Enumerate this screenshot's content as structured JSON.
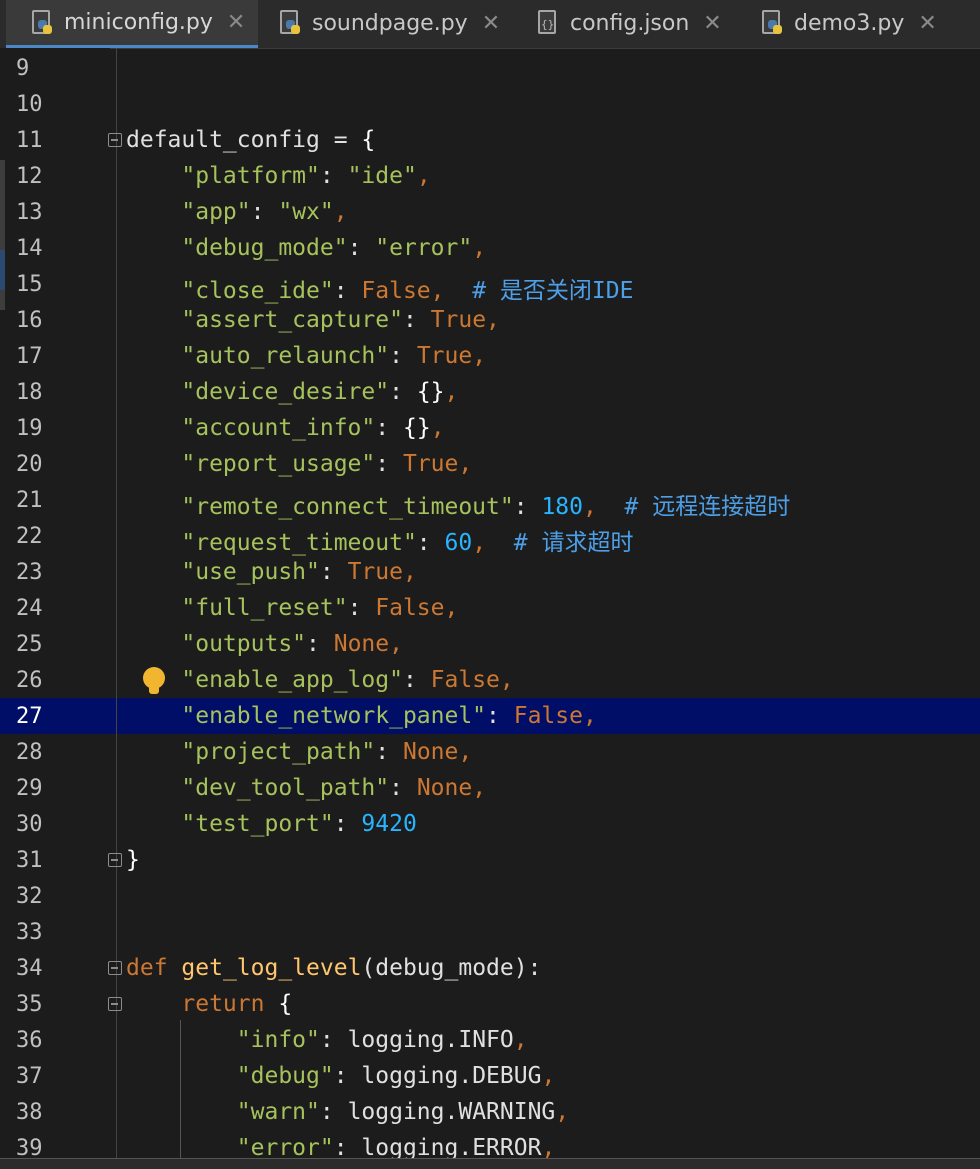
{
  "tabs": [
    {
      "label": "miniconfig.py",
      "icon": "python-file-icon",
      "active": true
    },
    {
      "label": "soundpage.py",
      "icon": "python-file-icon",
      "active": false
    },
    {
      "label": "config.json",
      "icon": "json-file-icon",
      "active": false
    },
    {
      "label": "demo3.py",
      "icon": "python-file-icon",
      "active": false
    }
  ],
  "editor": {
    "highlighted_line": 27,
    "lines": [
      {
        "num": "9",
        "code": ""
      },
      {
        "num": "10",
        "code": ""
      },
      {
        "num": "11",
        "code": "default_config = {"
      },
      {
        "num": "12",
        "code": "    \"platform\": \"ide\","
      },
      {
        "num": "13",
        "code": "    \"app\": \"wx\","
      },
      {
        "num": "14",
        "code": "    \"debug_mode\": \"error\","
      },
      {
        "num": "15",
        "code": "    \"close_ide\": False,  # 是否关闭IDE"
      },
      {
        "num": "16",
        "code": "    \"assert_capture\": True,"
      },
      {
        "num": "17",
        "code": "    \"auto_relaunch\": True,"
      },
      {
        "num": "18",
        "code": "    \"device_desire\": {},"
      },
      {
        "num": "19",
        "code": "    \"account_info\": {},"
      },
      {
        "num": "20",
        "code": "    \"report_usage\": True,"
      },
      {
        "num": "21",
        "code": "    \"remote_connect_timeout\": 180,  # 远程连接超时"
      },
      {
        "num": "22",
        "code": "    \"request_timeout\": 60,  # 请求超时"
      },
      {
        "num": "23",
        "code": "    \"use_push\": True,"
      },
      {
        "num": "24",
        "code": "    \"full_reset\": False,"
      },
      {
        "num": "25",
        "code": "    \"outputs\": None,"
      },
      {
        "num": "26",
        "code": "    \"enable_app_log\": False,"
      },
      {
        "num": "27",
        "code": "    \"enable_network_panel\": False,"
      },
      {
        "num": "28",
        "code": "    \"project_path\": None,"
      },
      {
        "num": "29",
        "code": "    \"dev_tool_path\": None,"
      },
      {
        "num": "30",
        "code": "    \"test_port\": 9420"
      },
      {
        "num": "31",
        "code": "}"
      },
      {
        "num": "32",
        "code": ""
      },
      {
        "num": "33",
        "code": ""
      },
      {
        "num": "34",
        "code": "def get_log_level(debug_mode):"
      },
      {
        "num": "35",
        "code": "    return {"
      },
      {
        "num": "36",
        "code": "        \"info\": logging.INFO,"
      },
      {
        "num": "37",
        "code": "        \"debug\": logging.DEBUG,"
      },
      {
        "num": "38",
        "code": "        \"warn\": logging.WARNING,"
      },
      {
        "num": "39",
        "code": "        \"error\": logging.ERROR,"
      }
    ]
  },
  "colors": {
    "background": "#1c1c1c",
    "highlight": "#000e68",
    "keyword": "#cc7832",
    "string": "#a5c25c",
    "number": "#28b4ff",
    "comment": "#4d9fe8",
    "function": "#ffc66d",
    "tab_accent": "#4a88c7"
  }
}
